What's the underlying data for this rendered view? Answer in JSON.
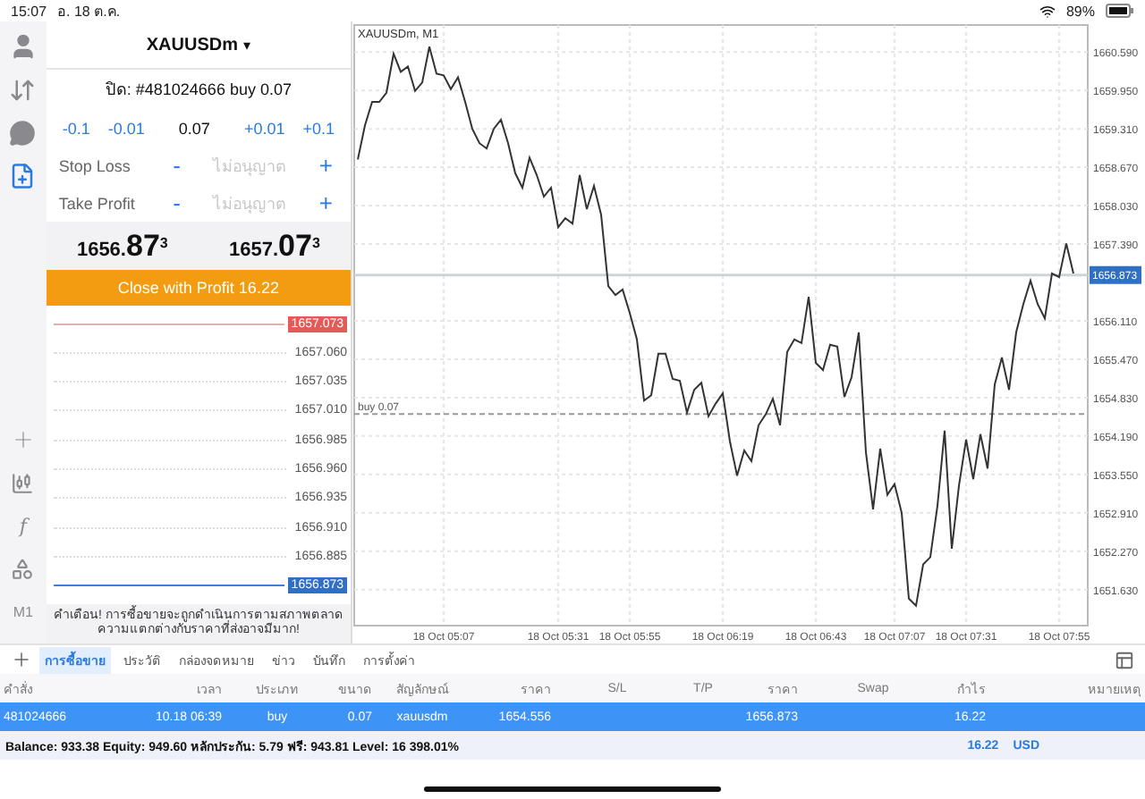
{
  "status_bar": {
    "time": "15:07",
    "date": "อ. 18 ต.ค.",
    "battery": "89%"
  },
  "rail_top": [
    {
      "selected": false
    },
    {
      "selected": false
    },
    {
      "selected": false
    },
    {
      "selected": true
    }
  ],
  "rail_bottom": [
    {
      "label": "f"
    },
    {
      "label": "M1"
    }
  ],
  "order_panel": {
    "symbol": "XAUUSDm",
    "caret": "▾",
    "position": "ปิด: #481024666 buy 0.07",
    "volume_minus": [
      "-0.1",
      "-0.01"
    ],
    "volume": "0.07",
    "volume_plus": [
      "+0.01",
      "+0.1"
    ],
    "stops": [
      {
        "label": "Stop Loss",
        "minus": "-",
        "placeholder": "ไม่อนุญาต",
        "plus": "+"
      },
      {
        "label": "Take Profit",
        "minus": "-",
        "placeholder": "ไม่อนุญาต",
        "plus": "+"
      }
    ],
    "quotes": [
      {
        "lead": "1656.",
        "big": "87",
        "sup": "3"
      },
      {
        "lead": "1657.",
        "big": "07",
        "sup": "3"
      }
    ],
    "close_button": "Close with Profit 16.22",
    "tick_chart": {
      "ask": "1657.073",
      "bid": "1656.873",
      "levels": [
        "1657.060",
        "1657.035",
        "1657.010",
        "1656.985",
        "1656.960",
        "1656.935",
        "1656.910",
        "1656.885"
      ]
    },
    "warning": "คำเตือน! การซื้อขายจะถูกดำเนินการตามสภาพตลาด ความแตกต่างกับราคาที่ส่งอาจมีมาก!"
  },
  "chart": {
    "title": "XAUUSDm, M1",
    "chart_data": {
      "type": "line",
      "categories": [
        null,
        null,
        null,
        null,
        null,
        null,
        null,
        null,
        null,
        null,
        null,
        null,
        "18 Oct 05:07",
        null,
        null,
        null,
        null,
        null,
        null,
        null,
        null,
        null,
        null,
        null,
        null,
        null,
        null,
        null,
        "18 Oct 05:31",
        null,
        null,
        null,
        null,
        null,
        null,
        null,
        null,
        null,
        "18 Oct 05:55",
        null,
        null,
        null,
        null,
        null,
        null,
        null,
        null,
        null,
        null,
        null,
        null,
        "18 Oct 06:19",
        null,
        null,
        null,
        null,
        null,
        null,
        null,
        null,
        null,
        null,
        null,
        null,
        "18 Oct 06:43",
        null,
        null,
        null,
        null,
        null,
        null,
        null,
        null,
        null,
        null,
        "18 Oct 07:07",
        null,
        null,
        null,
        null,
        null,
        null,
        null,
        null,
        null,
        "18 Oct 07:31",
        null,
        null,
        null,
        null,
        null,
        null,
        null,
        null,
        null,
        null,
        null,
        null,
        "18 Oct 07:55",
        null,
        null
      ],
      "series": [
        {
          "color": "#333333",
          "values": [
            1658.8,
            1659.37,
            1659.76,
            1659.76,
            1659.91,
            1660.56,
            1660.26,
            1660.35,
            1659.94,
            1660.08,
            1660.68,
            1660.23,
            1660.2,
            1659.97,
            1660.17,
            1659.76,
            1659.31,
            1659.07,
            1658.98,
            1659.31,
            1659.46,
            1659.07,
            1658.57,
            1658.33,
            1658.83,
            1658.54,
            1658.18,
            1658.33,
            1657.67,
            1657.82,
            1657.73,
            1658.54,
            1657.97,
            1658.36,
            1657.88,
            1656.69,
            1656.54,
            1656.63,
            1656.24,
            1655.8,
            1654.78,
            1654.87,
            1655.56,
            1655.56,
            1655.14,
            1655.11,
            1654.58,
            1654.96,
            1655.08,
            1654.52,
            1654.73,
            1654.9,
            1654.1,
            1653.53,
            1653.95,
            1653.77,
            1654.37,
            1654.55,
            1654.81,
            1654.37,
            1655.59,
            1655.8,
            1655.74,
            1656.51,
            1655.41,
            1655.29,
            1655.71,
            1655.68,
            1654.84,
            1655.17,
            1655.92,
            1653.92,
            1652.97,
            1653.98,
            1653.21,
            1653.39,
            1652.91,
            1651.48,
            1651.36,
            1652.05,
            1652.17,
            1653.03,
            1654.28,
            1652.31,
            1653.36,
            1654.13,
            1653.47,
            1654.22,
            1653.65,
            1655.05,
            1655.5,
            1654.96,
            1655.92,
            1656.39,
            1656.78,
            1656.39,
            1656.15,
            1656.9,
            1656.84,
            1657.4,
            1656.9
          ]
        }
      ],
      "ylim": [
        1651.03,
        1661.04
      ],
      "grid": true,
      "ref_lines": [
        {
          "axis": "y",
          "value": 1654.556,
          "label": "buy 0.07"
        },
        {
          "axis": "y",
          "value": 1656.873,
          "label": "1656.873"
        }
      ],
      "yticks": [
        {
          "value": 1660.59,
          "label": "1660.590"
        },
        {
          "value": 1659.95,
          "label": "1659.950"
        },
        {
          "value": 1659.31,
          "label": "1659.310"
        },
        {
          "value": 1658.67,
          "label": "1658.670"
        },
        {
          "value": 1658.03,
          "label": "1658.030"
        },
        {
          "value": 1657.39,
          "label": "1657.390"
        },
        {
          "value": 1656.11,
          "label": "1656.110"
        },
        {
          "value": 1655.47,
          "label": "1655.470"
        },
        {
          "value": 1654.83,
          "label": "1654.830"
        },
        {
          "value": 1654.19,
          "label": "1654.190"
        },
        {
          "value": 1653.55,
          "label": "1653.550"
        },
        {
          "value": 1652.91,
          "label": "1652.910"
        },
        {
          "value": 1652.27,
          "label": "1652.270"
        },
        {
          "value": 1651.63,
          "label": "1651.630"
        }
      ]
    }
  },
  "tabs": [
    {
      "label": "การซื้อขาย",
      "selected": true
    },
    {
      "label": "ประวัติ",
      "selected": false
    },
    {
      "label": "กล่องจดหมาย",
      "selected": false
    },
    {
      "label": "ข่าว",
      "selected": false
    },
    {
      "label": "บันทึก",
      "selected": false
    },
    {
      "label": "การตั้งค่า",
      "selected": false
    }
  ],
  "columns": [
    "คำสั่ง",
    "เวลา",
    "ประเภท",
    "ขนาด",
    "สัญลักษณ์",
    "ราคา",
    "S/L",
    "T/P",
    "ราคา",
    "Swap",
    "กำไร",
    "หมายเหตุ"
  ],
  "rows": [
    {
      "selected": true,
      "cells": [
        "481024666",
        "10.18 06:39",
        "buy",
        "0.07",
        "xauusdm",
        "1654.556",
        null,
        null,
        "1656.873",
        null,
        "16.22",
        null
      ]
    }
  ],
  "summary": {
    "text": "Balance: 933.38 Equity: 949.60 หลักประกัน: 5.79 ฟรี: 943.81 Level: 16 398.01%",
    "profit": "16.22",
    "currency": "USD"
  }
}
